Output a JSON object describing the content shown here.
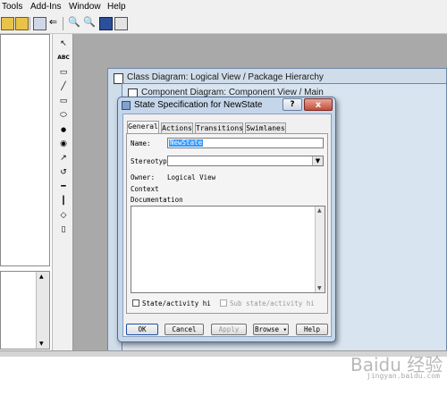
{
  "menubar": {
    "items": [
      "Tools",
      "Add-Ins",
      "Window",
      "Help"
    ]
  },
  "palette": {
    "abc_label": "ABC"
  },
  "windows": {
    "class_diagram_title": "Class Diagram: Logical View / Package Hierarchy",
    "component_diagram_title": "Component Diagram: Component View / Main"
  },
  "dialog": {
    "title": "State Specification for NewState",
    "help_caption": "?",
    "close_caption": "x",
    "tabs": [
      "General",
      "Actions",
      "Transitions",
      "Swimlanes"
    ],
    "name_label": "Name:",
    "name_value": "NewState",
    "stereotype_label": "Stereotype:",
    "stereotype_value": "",
    "owner_label": "Owner:",
    "owner_value": "Logical View",
    "context_label": "Context",
    "documentation_label": "Documentation",
    "documentation_value": "",
    "checkbox_state_activity": "State/activity hi",
    "checkbox_sub_state": "Sub state/activity hi",
    "buttons": {
      "ok": "OK",
      "cancel": "Cancel",
      "apply": "Apply",
      "browse": "Browse ▾",
      "help": "Help"
    }
  },
  "watermark": {
    "text": "Baidu 经验",
    "sub": "jingyan.baidu.com"
  }
}
